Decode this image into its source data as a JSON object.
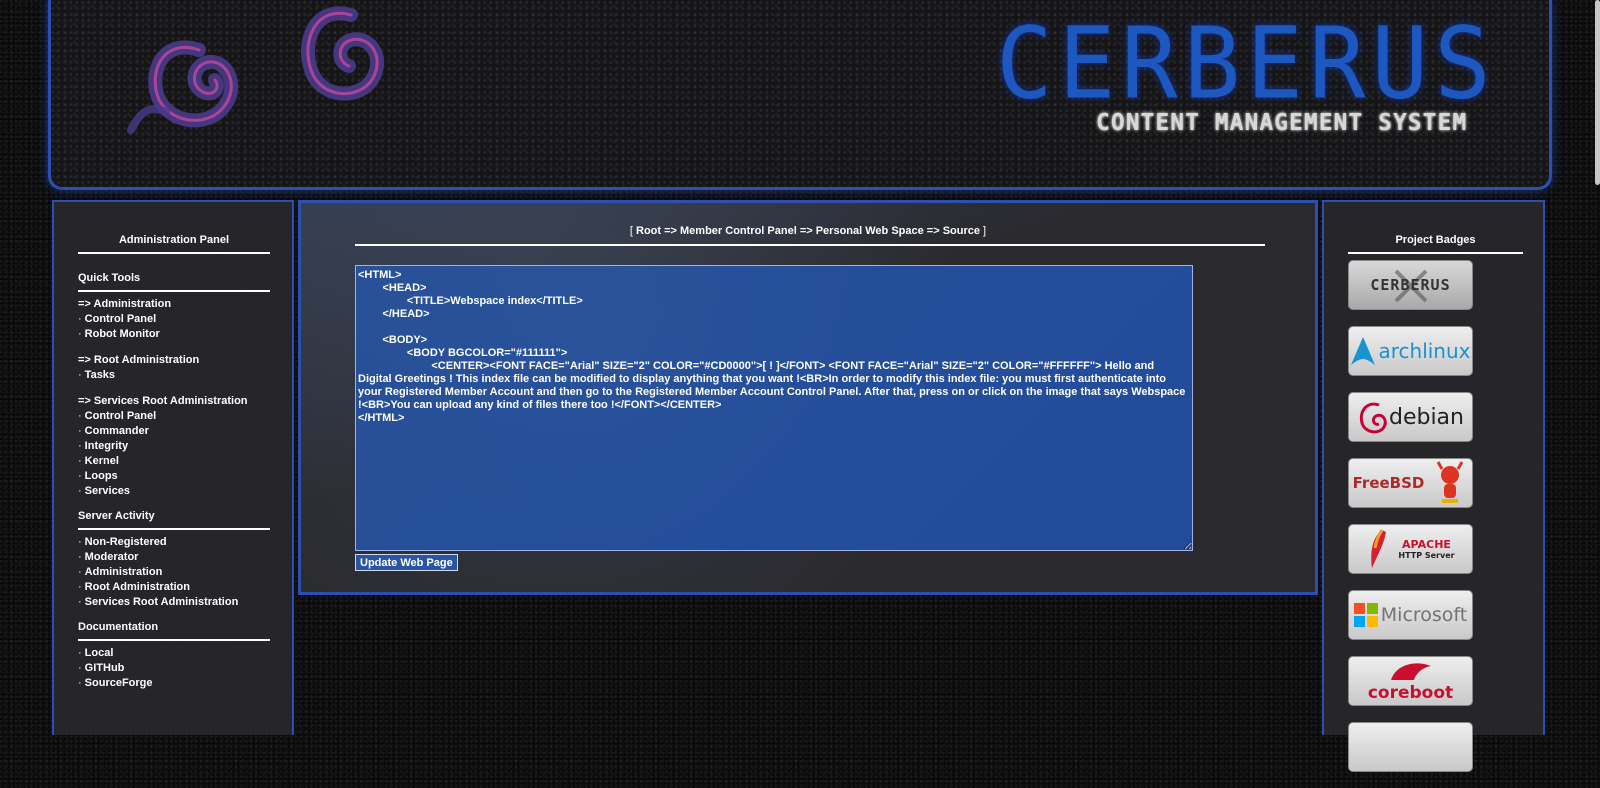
{
  "banner": {
    "title": "CERBERUS",
    "subtitle": "CONTENT MANAGEMENT SYSTEM"
  },
  "left_panel": {
    "heading": "Administration Panel",
    "quick_tools": {
      "title": "Quick Tools",
      "groups": [
        {
          "head": "=> Administration",
          "items": [
            "Control Panel",
            "Robot Monitor"
          ]
        },
        {
          "head": "=> Root Administration",
          "items": [
            "Tasks"
          ]
        },
        {
          "head": "=> Services Root Administration",
          "items": [
            "Control Panel",
            "Commander",
            "Integrity",
            "Kernel",
            "Loops",
            "Services"
          ]
        }
      ]
    },
    "server_activity": {
      "title": "Server Activity",
      "items": [
        "Non-Registered",
        "Moderator",
        "Administration",
        "Root Administration",
        "Services Root Administration"
      ]
    },
    "documentation": {
      "title": "Documentation",
      "items": [
        "Local",
        "GITHub",
        "SourceForge"
      ]
    }
  },
  "main": {
    "breadcrumb": {
      "open": "[ ",
      "path": "Root => Member Control Panel => Personal Web Space => Source",
      "close": " ]"
    },
    "source": "<HTML>\n        <HEAD>\n                <TITLE>Webspace index</TITLE>\n        </HEAD>\n\n        <BODY>\n                <BODY BGCOLOR=\"#111111\">\n                        <CENTER><FONT FACE=\"Arial\" SIZE=\"2\" COLOR=\"#CD0000\">[ ! ]</FONT> <FONT FACE=\"Arial\" SIZE=\"2\" COLOR=\"#FFFFFF\"> Hello and Digital Greetings ! This index file can be modified to display anything that you want !<BR>In order to modify this index file: you must first authenticate into your Registered Member Account and then go to the Registered Member Account Control Panel. After that, press on or click on the image that says Webspace !<BR>You can upload any kind of files there too !</FONT></CENTER>\n</HTML>",
    "update_button": "Update Web Page"
  },
  "right_panel": {
    "heading": "Project Badges",
    "badges": [
      {
        "icon": "cerberus-badge-icon",
        "text": "CERBERUS"
      },
      {
        "icon": "archlinux-badge-icon",
        "text": "archlinux"
      },
      {
        "icon": "debian-badge-icon",
        "text": "debian"
      },
      {
        "icon": "freebsd-badge-icon",
        "text": "FreeBSD"
      },
      {
        "icon": "apache-badge-icon",
        "text": "APACHE",
        "subtext": "HTTP Server"
      },
      {
        "icon": "microsoft-badge-icon",
        "text": "Microsoft"
      },
      {
        "icon": "coreboot-badge-icon",
        "text": "coreboot"
      }
    ]
  },
  "colors": {
    "accent_blue": "#2c4fb0",
    "editor_blue": "#2c5aa8",
    "panel_bg": "#28282c"
  }
}
